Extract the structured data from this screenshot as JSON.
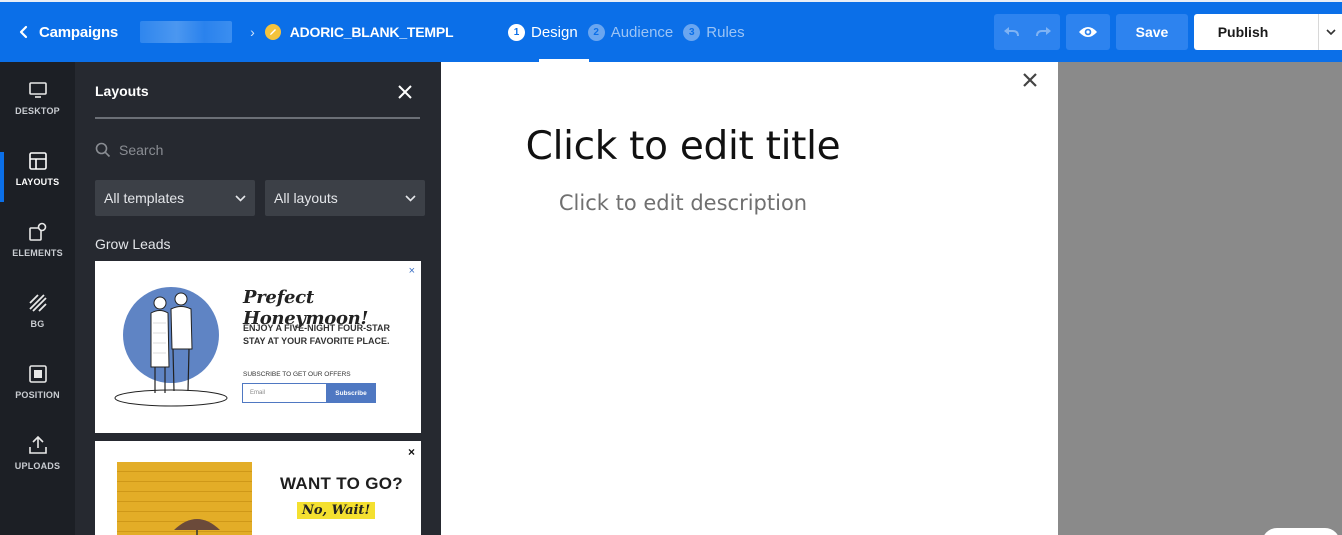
{
  "header": {
    "back_label": "Campaigns",
    "campaign_name": "ADORIC_BLANK_TEMPL",
    "steps": [
      {
        "num": "1",
        "label": "Design"
      },
      {
        "num": "2",
        "label": "Audience"
      },
      {
        "num": "3",
        "label": "Rules"
      }
    ],
    "save_label": "Save",
    "publish_label": "Publish"
  },
  "rail": {
    "items": [
      {
        "label": "DESKTOP",
        "icon": "desktop-icon"
      },
      {
        "label": "LAYOUTS",
        "icon": "layouts-icon"
      },
      {
        "label": "ELEMENTS",
        "icon": "elements-icon"
      },
      {
        "label": "BG",
        "icon": "background-icon"
      },
      {
        "label": "POSITION",
        "icon": "position-icon"
      },
      {
        "label": "UPLOADS",
        "icon": "upload-icon"
      }
    ]
  },
  "panel": {
    "title": "Layouts",
    "search_placeholder": "Search",
    "template_filter": "All templates",
    "layout_filter": "All layouts",
    "section_label": "Grow Leads",
    "cards": [
      {
        "title": "Prefect Honeymoon!",
        "text": "ENJOY A FIVE-NIGHT FOUR-STAR STAY AT YOUR FAVORITE PLACE.",
        "subscribe_label": "SUBSCRIBE TO GET OUR OFFERS",
        "email_placeholder": "Email",
        "button_label": "Subscribe",
        "close": "×"
      },
      {
        "title": "WANT TO GO?",
        "subtitle": "No, Wait!",
        "close": "×"
      }
    ]
  },
  "canvas": {
    "title": "Click to edit title",
    "description": "Click to edit description"
  },
  "colors": {
    "brand_blue": "#0b6fe8",
    "rail_bg": "#1c1f25",
    "panel_bg": "#262930",
    "status_yellow": "#f4c33d"
  }
}
